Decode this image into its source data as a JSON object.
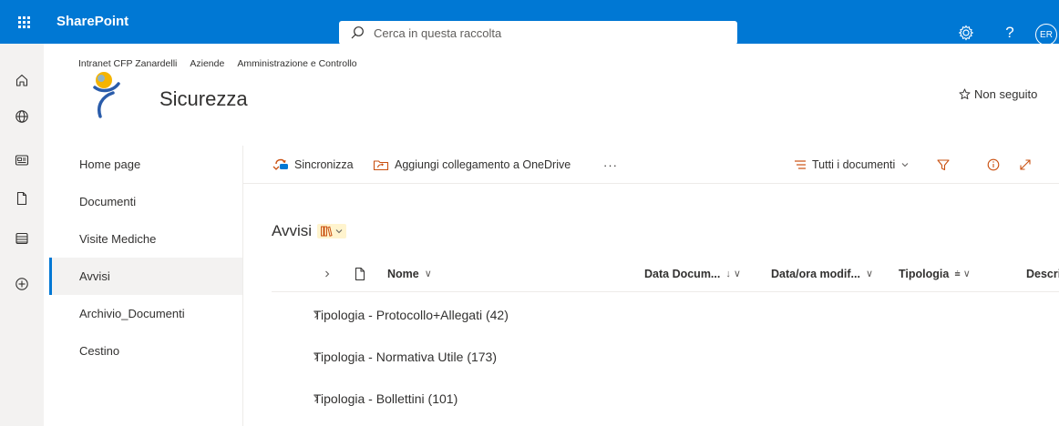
{
  "suite": {
    "app_name": "SharePoint",
    "search_placeholder": "Cerca in questa raccolta",
    "help_label": "?",
    "avatar_initials": "ER"
  },
  "breadcrumbs": [
    "Intranet CFP Zanardelli",
    "Aziende",
    "Amministrazione e Controllo"
  ],
  "site": {
    "title": "Sicurezza",
    "follow_label": "Non seguito"
  },
  "nav": {
    "items": [
      {
        "label": "Home page",
        "active": false
      },
      {
        "label": "Documenti",
        "active": false
      },
      {
        "label": "Visite Mediche",
        "active": false
      },
      {
        "label": "Avvisi",
        "active": true
      },
      {
        "label": "Archivio_Documenti",
        "active": false
      },
      {
        "label": "Cestino",
        "active": false
      }
    ]
  },
  "commands": {
    "sync": "Sincronizza",
    "onedrive": "Aggiungi collegamento a OneDrive",
    "more": "···",
    "view": "Tutti i documenti"
  },
  "list": {
    "title": "Avvisi",
    "columns": [
      {
        "label": "Nome",
        "indicator": "∨"
      },
      {
        "label": "Data Docum...",
        "indicator": "↓ ∨"
      },
      {
        "label": "Data/ora modif...",
        "indicator": "∨"
      },
      {
        "label": "Tipologia",
        "indicator": "⩧ ∨"
      },
      {
        "label": "Descri",
        "indicator": ""
      }
    ],
    "groups": [
      "Tipologia - Protocollo+Allegati (42)",
      "Tipologia - Normativa Utile (173)",
      "Tipologia - Bollettini (101)"
    ]
  },
  "colors": {
    "brand_blue": "#0078d4",
    "accent_orange": "#ca5010",
    "nav_active_bg": "#f3f2f1"
  }
}
